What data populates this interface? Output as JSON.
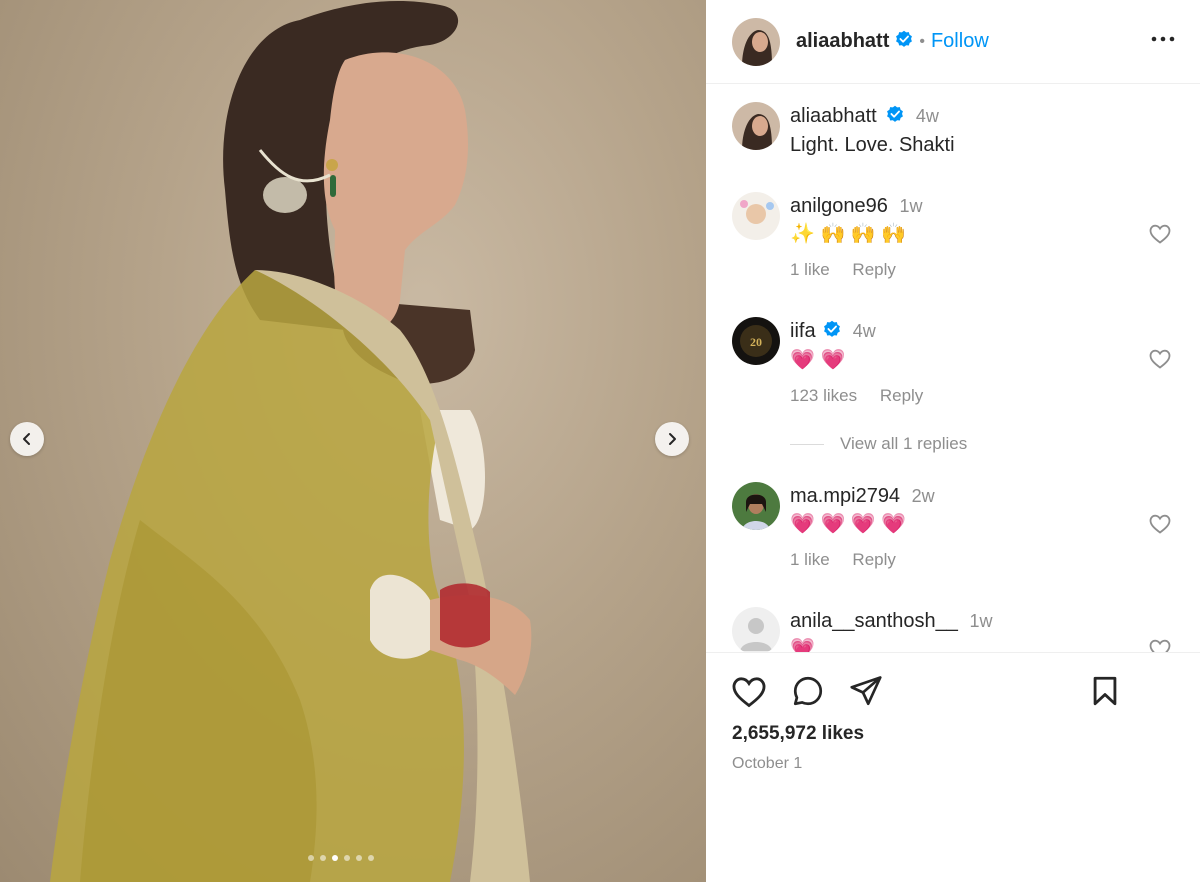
{
  "post": {
    "author": "aliaabhatt",
    "follow_label": "Follow",
    "separator": "•",
    "caption_user": "aliaabhatt",
    "caption_time": "4w",
    "caption_text": "Light. Love. Shakti",
    "likes": "2,655,972 likes",
    "date": "October 1"
  },
  "comments": [
    {
      "user": "anilgone96",
      "time": "1w",
      "text": "✨ 🙌 🙌 🙌",
      "likes": "1 like",
      "reply": "Reply"
    },
    {
      "user": "iifa",
      "time": "4w",
      "text": "💗 💗",
      "likes": "123 likes",
      "reply": "Reply",
      "verified": true
    },
    {
      "user": "ma.mpi2794",
      "time": "2w",
      "text": "💗 💗 💗 💗",
      "likes": "1 like",
      "reply": "Reply"
    },
    {
      "user": "anila__santhosh__",
      "time": "1w",
      "text": "💗",
      "likes": "",
      "reply": ""
    }
  ],
  "view_replies": "View all 1 replies",
  "carousel": {
    "count": 6,
    "active": 2
  },
  "icons": {
    "prev": "chevron-left-icon",
    "next": "chevron-right-icon",
    "more": "more-icon",
    "like": "heart-icon",
    "comment": "comment-icon",
    "share": "share-icon",
    "save": "bookmark-icon",
    "verified": "verified-badge-icon"
  },
  "colors": {
    "accent": "#0095f6",
    "verified": "#0095f6",
    "muted": "#8e8e8e"
  }
}
